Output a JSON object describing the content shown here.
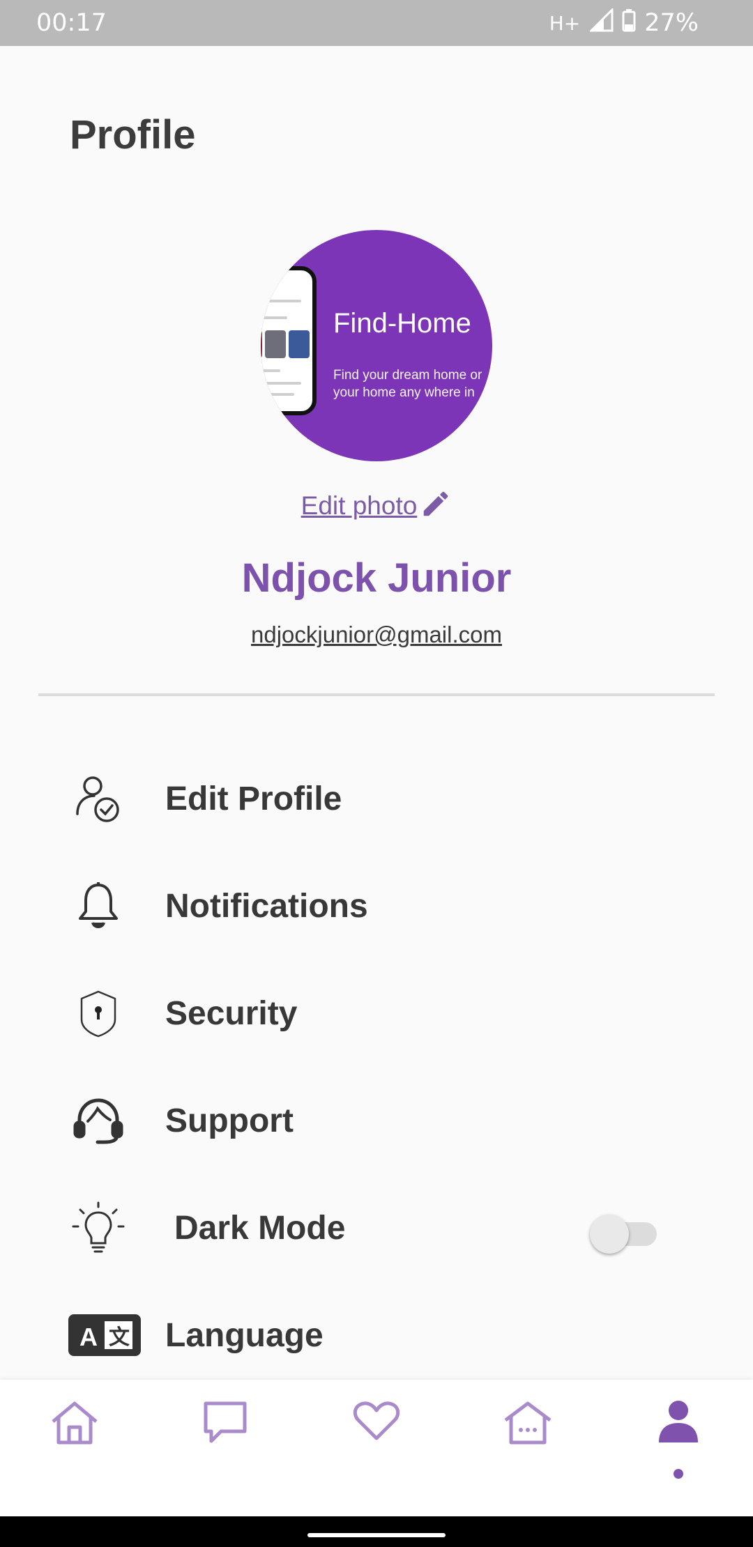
{
  "status_bar": {
    "time": "00:17",
    "network": "H+",
    "battery": "27%"
  },
  "page": {
    "title": "Profile"
  },
  "profile": {
    "avatar_brand": "Find-Home",
    "avatar_tagline": "Find your dream home or\nyour home any where in",
    "edit_photo_label": "Edit photo",
    "name": "Ndjock Junior",
    "email": "ndjockjunior@gmail.com"
  },
  "menu": {
    "items": [
      {
        "label": "Edit Profile",
        "icon": "user-check-icon"
      },
      {
        "label": "Notifications",
        "icon": "bell-icon"
      },
      {
        "label": "Security",
        "icon": "shield-icon"
      },
      {
        "label": "Support",
        "icon": "headset-icon"
      },
      {
        "label": "Dark Mode",
        "icon": "lightbulb-icon",
        "toggle_on": false
      },
      {
        "label": "Language",
        "icon": "translate-icon"
      }
    ]
  },
  "bottom_nav": {
    "items": [
      {
        "name": "home",
        "icon": "home-icon",
        "active": false
      },
      {
        "name": "messages",
        "icon": "chat-icon",
        "active": false
      },
      {
        "name": "favorites",
        "icon": "heart-icon",
        "active": false
      },
      {
        "name": "listings",
        "icon": "house-dots-icon",
        "active": false
      },
      {
        "name": "profile",
        "icon": "person-icon",
        "active": true
      }
    ]
  },
  "colors": {
    "accent": "#7d52ad",
    "status_bar": "#b9b9b9",
    "avatar_bg": "#7b35b6",
    "text_dark": "#383838"
  }
}
